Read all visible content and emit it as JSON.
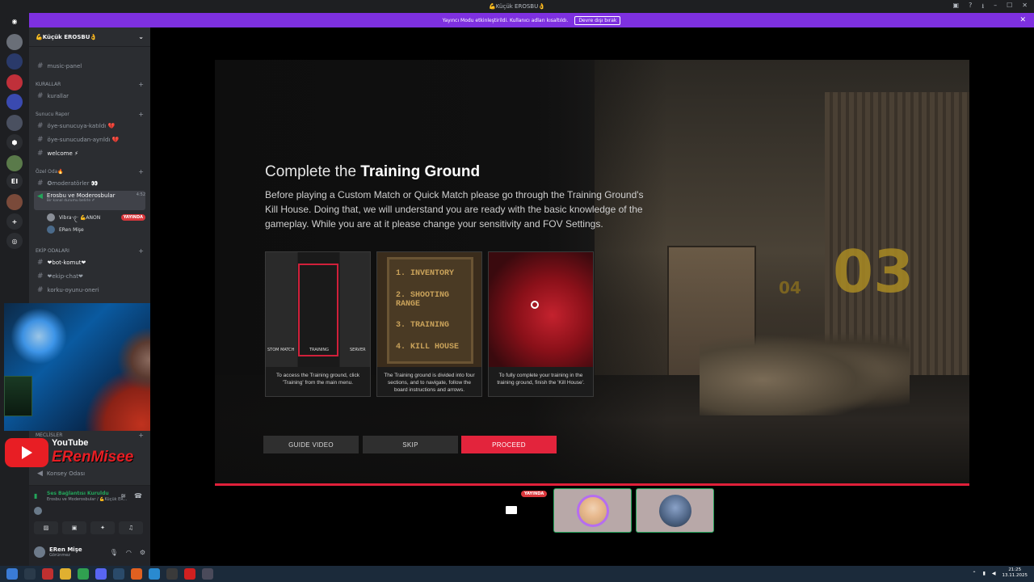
{
  "window": {
    "title": "💪Küçük EROSBU👌"
  },
  "banner": {
    "text": "Yayıncı Modu etkinleştirildi. Kullanıcı adları kısaltıldı.",
    "button": "Devre dışı bırak",
    "close": "✕"
  },
  "server_rail": {
    "label_el": "EI"
  },
  "server": {
    "name": "💪Küçük EROSBU👌"
  },
  "channels": {
    "music_panel": "music-panel",
    "cat_kurallar": "KURALLAR",
    "kurallar": "kurallar",
    "cat_rapor": "Sunucu Rapor",
    "katildi": "öye-sunucuya-katıldı 💔",
    "ayrildi": "öye-sunucudan-ayrıldı 💔",
    "welcome": "welcome ⚡",
    "cat_ozel": "Özel Oda🔥",
    "moderatorler": "✪moderatörler 👀",
    "voice": "Erosbu ve Moderosbular",
    "voice_time": "4:52",
    "voice_status": "Bir kanal durumu belirle ✐",
    "voice_user1": "Vibra·ꪖ· 💪ANON",
    "live": "YAYINDA",
    "voice_user2": "ERen Mişe",
    "cat_ekip": "EKİP ODALARI",
    "bot": "❤bot-komut❤",
    "ekip_chat": "❤ekip-chat❤",
    "korku": "korku-oyunu-oneri",
    "cat_meclis": "MECLİSLER",
    "konsey": "Konsey Odası"
  },
  "youtube": {
    "brand": "YouTube",
    "channel": "ERenMisee"
  },
  "voice_panel": {
    "status": "Ses Bağlantısı Kuruldu",
    "sub": "Erosbu ve Moderosbular / 💪Küçük ER..."
  },
  "user": {
    "name": "ERen Mişe",
    "status": "Görünmez"
  },
  "game": {
    "title_pre": "Complete the",
    "title_bold": "Training Ground",
    "description": "Before playing a Custom Match or Quick Match please go through the Training Ground's Kill House. Doing that, we will understand you are ready with the basic knowledge of the gameplay. While you are at it please change your sensitivity and FOV Settings.",
    "card1_caption": "To access the Training ground, click 'Training' from the main menu.",
    "card1_tags": [
      "STOM MATCH",
      "TRAINING",
      "SERVER"
    ],
    "card2_board": [
      "1. INVENTORY",
      "2. SHOOTING RANGE",
      "3. TRAINING",
      "4. KILL HOUSE"
    ],
    "card2_caption": "The Training ground is divided into four sections, and to navigate, follow the board instructions and arrows.",
    "card3_caption": "To fully complete your training in the training ground, finish the 'Kill House'.",
    "buttons": {
      "guide": "GUIDE VIDEO",
      "skip": "SKIP",
      "proceed": "PROCEED"
    },
    "numbers": {
      "big": "03",
      "small": "04"
    }
  },
  "stream_tiles": {
    "live": "YAYINDA"
  },
  "taskbar": {
    "time": "21:25",
    "date": "13.11.2025"
  },
  "colors": {
    "accent": "#7e30e0",
    "proceed": "#e3243c",
    "voice_green": "#23a55a"
  }
}
